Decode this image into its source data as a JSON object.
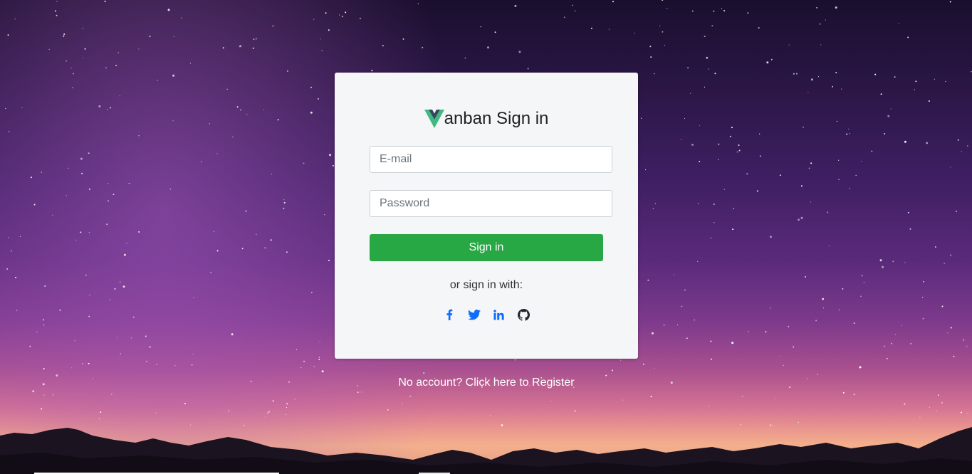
{
  "colors": {
    "accent_green": "#28a745",
    "link_blue": "#0d6efd",
    "card_background": "#f5f6f8",
    "logo_green": "#42b883",
    "logo_dark": "#35495e"
  },
  "card": {
    "logo_icon": "vue-logo-icon",
    "title": "anban Sign in",
    "email": {
      "placeholder": "E-mail",
      "value": ""
    },
    "password": {
      "placeholder": "Password",
      "value": ""
    },
    "sign_in_label": "Sign in",
    "alt_sign_in_text": "or sign in with:",
    "social": [
      {
        "name": "facebook",
        "icon": "facebook-icon"
      },
      {
        "name": "twitter",
        "icon": "twitter-icon"
      },
      {
        "name": "linkedin",
        "icon": "linkedin-icon"
      },
      {
        "name": "github",
        "icon": "github-icon"
      }
    ]
  },
  "register_link": "No account? Click here to Register"
}
